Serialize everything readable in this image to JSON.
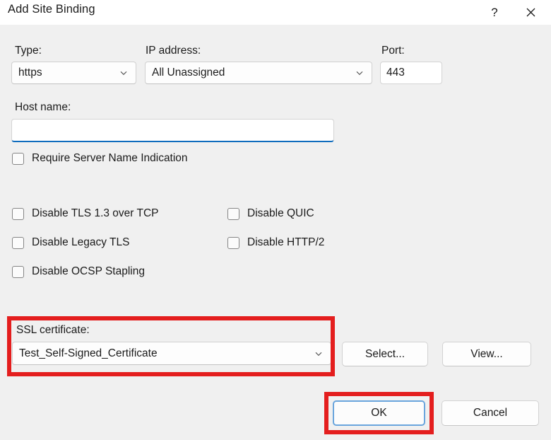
{
  "window": {
    "title": "Add Site Binding",
    "help_icon": "question-mark-icon",
    "close_icon": "close-x-icon"
  },
  "form": {
    "type": {
      "label": "Type:",
      "value": "https",
      "chevron_icon": "chevron-down-icon"
    },
    "ip_address": {
      "label": "IP address:",
      "value": "All Unassigned",
      "chevron_icon": "chevron-down-icon"
    },
    "port": {
      "label": "Port:",
      "value": "443",
      "placeholder": ""
    },
    "host_name": {
      "label": "Host name:",
      "value": "",
      "placeholder": ""
    },
    "require_sni": {
      "label": "Require Server Name Indication",
      "checked": false
    },
    "protocol_options": [
      {
        "label": "Disable TLS 1.3 over TCP",
        "checked": false
      },
      {
        "label": "Disable Legacy TLS",
        "checked": false
      },
      {
        "label": "Disable OCSP Stapling",
        "checked": false
      },
      {
        "label": "Disable QUIC",
        "checked": false
      },
      {
        "label": "Disable HTTP/2",
        "checked": false
      }
    ],
    "ssl_certificate": {
      "label": "SSL certificate:",
      "value": "Test_Self-Signed_Certificate",
      "chevron_icon": "chevron-down-icon",
      "select_button": "Select...",
      "view_button": "View..."
    }
  },
  "footer": {
    "ok_button": "OK",
    "cancel_button": "Cancel"
  },
  "annotations": {
    "highlight_color": "#e41e1e",
    "accent_color": "#0f6cbd",
    "focus_ring_color": "#6aa5dd"
  }
}
